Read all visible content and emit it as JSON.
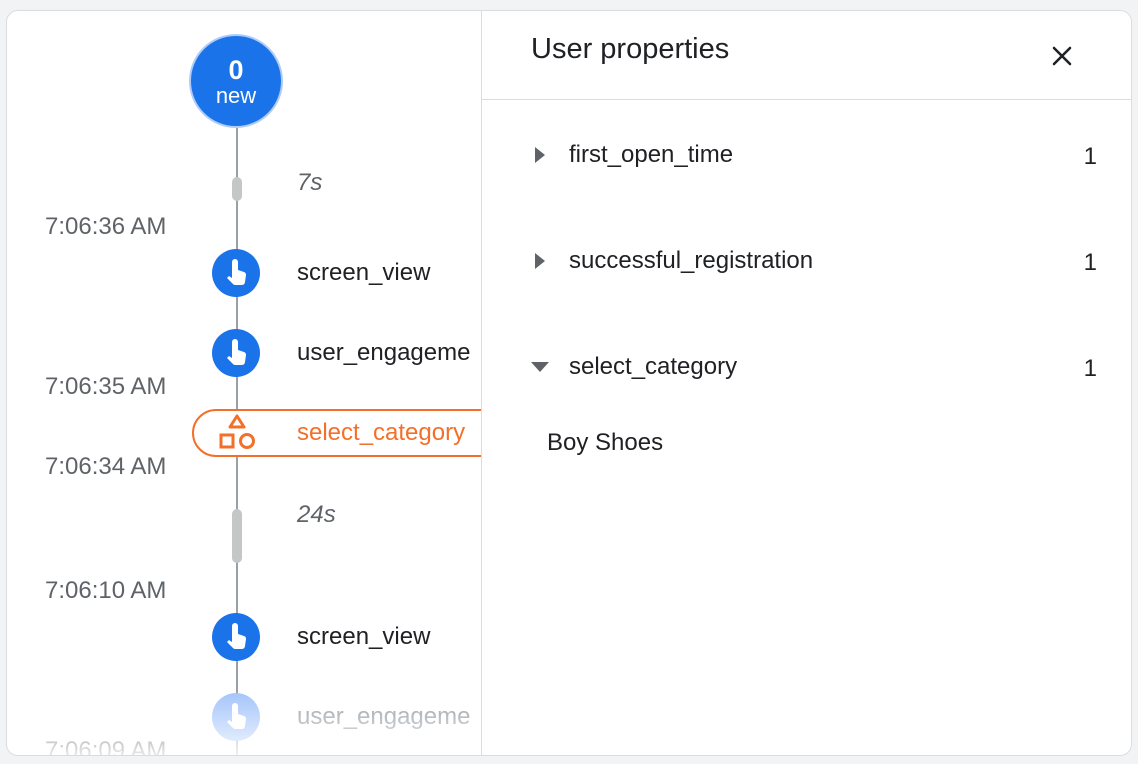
{
  "timeline": {
    "badge": {
      "count": "0",
      "label": "new"
    },
    "durations": [
      "7s",
      "24s"
    ],
    "times": [
      "7:06:36 AM",
      "7:06:35 AM",
      "7:06:34 AM",
      "7:06:10 AM",
      "7:06:09 AM"
    ],
    "events": [
      {
        "label": "screen_view",
        "icon": "touch-icon"
      },
      {
        "label": "user_engageme",
        "icon": "touch-icon"
      },
      {
        "label": "select_category",
        "icon": "shapes-icon",
        "selected": true
      },
      {
        "label": "screen_view",
        "icon": "touch-icon"
      },
      {
        "label": "user_engageme",
        "icon": "touch-icon"
      }
    ]
  },
  "user_properties": {
    "title": "User properties",
    "close_icon": "close-icon",
    "items": [
      {
        "name": "first_open_time",
        "count": "1",
        "expanded": false
      },
      {
        "name": "successful_registration",
        "count": "1",
        "expanded": false
      },
      {
        "name": "select_category",
        "count": "1",
        "expanded": true,
        "value": "Boy Shoes"
      }
    ]
  },
  "colors": {
    "primary": "#1a73e8",
    "selected": "#f3702b",
    "muted_text": "#5f6368"
  }
}
